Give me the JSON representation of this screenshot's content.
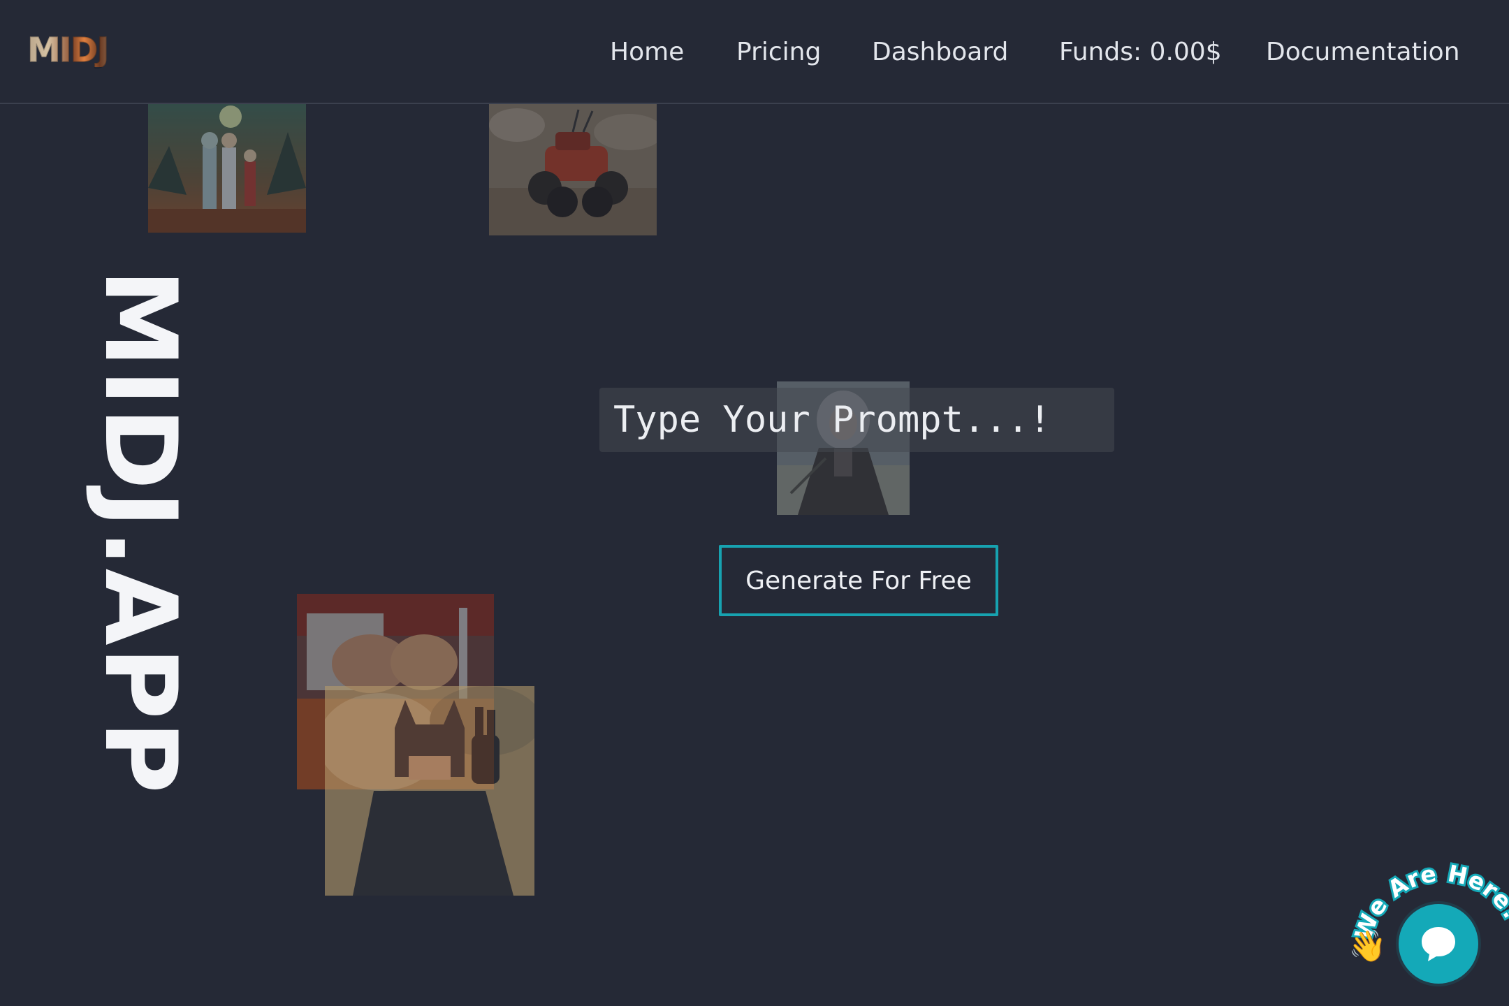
{
  "header": {
    "logo_text": "MIDJ",
    "nav": [
      {
        "label": "Home"
      },
      {
        "label": "Pricing"
      },
      {
        "label": "Dashboard"
      },
      {
        "label": "Funds: 0.00$"
      },
      {
        "label": "Documentation"
      }
    ]
  },
  "brand": {
    "vertical_title": "MIDJ.APP"
  },
  "hero": {
    "prompt_placeholder": "Type Your Prompt...!",
    "generate_label": "Generate For Free"
  },
  "gallery": [
    {
      "icon": "cartoon-characters-image"
    },
    {
      "icon": "toy-car-image"
    },
    {
      "icon": "anime-girl-image"
    },
    {
      "icon": "cats-image"
    },
    {
      "icon": "batman-image"
    }
  ],
  "chat": {
    "badge_text": "We Are Here!",
    "wave_icon": "waving-hand-icon",
    "button_icon": "chat-bubble-icon"
  },
  "colors": {
    "background": "#252936",
    "accent": "#17a2b0",
    "chat_button": "#14a9b8",
    "text": "#e6e8ee"
  }
}
